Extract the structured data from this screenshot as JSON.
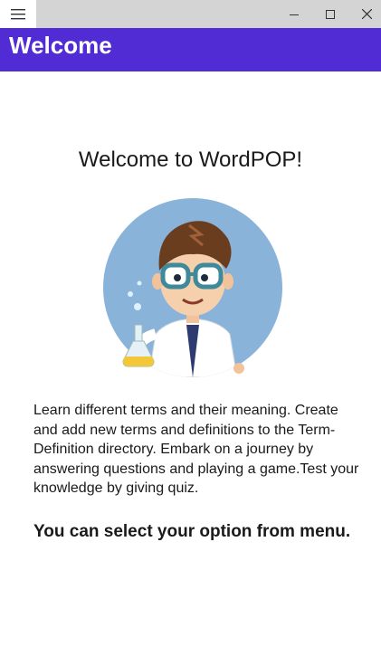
{
  "header": {
    "title": "Welcome"
  },
  "main": {
    "heading": "Welcome to WordPOP!",
    "description": "Learn different terms and their meaning. Create and add new terms and definitions to the Term-Definition directory. Embark on a journey by answering questions and playing a game.Test your knowledge by giving quiz.",
    "menu_hint": "You can select your option from menu."
  },
  "icons": {
    "menu": "hamburger-icon",
    "minimize": "minimize-icon",
    "maximize": "maximize-icon",
    "close": "close-icon"
  },
  "colors": {
    "header_bg": "#512bd4",
    "titlebar_bg": "#d4d4d4",
    "avatar_bg": "#8ab3d9"
  }
}
